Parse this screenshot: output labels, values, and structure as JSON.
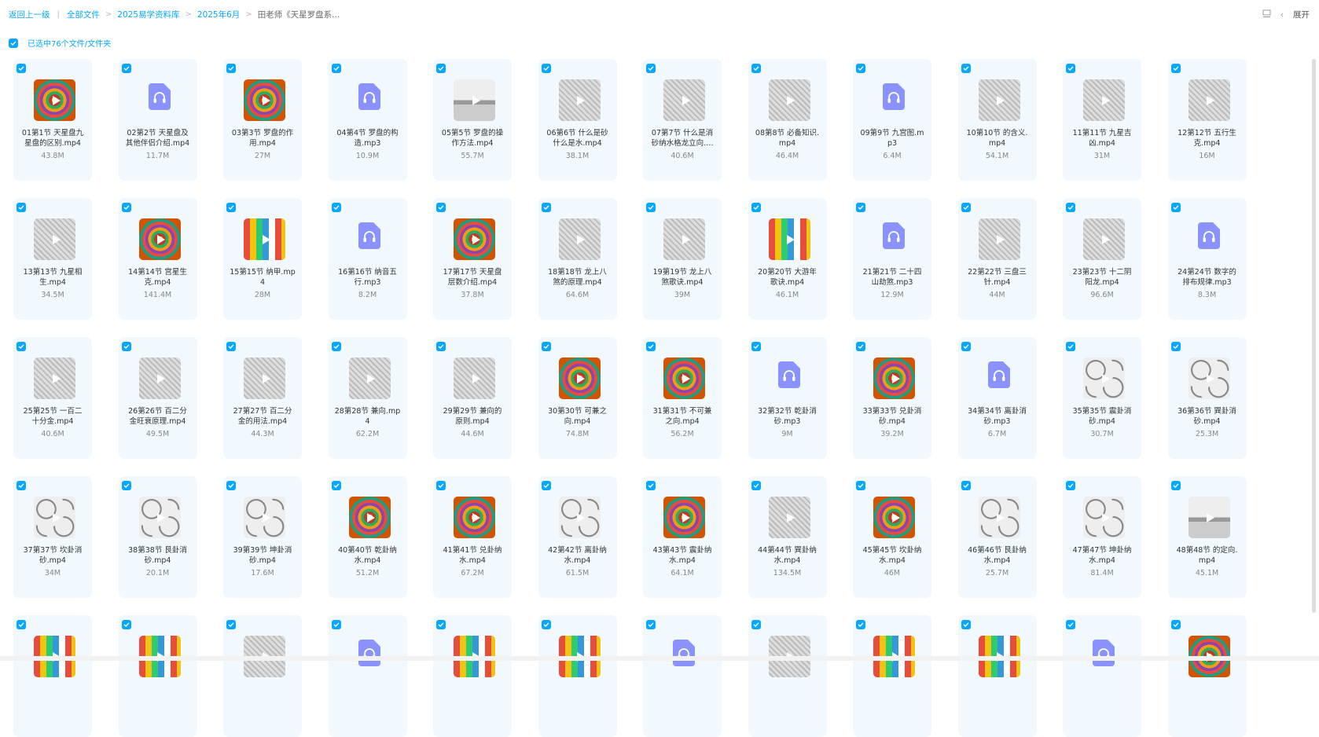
{
  "breadcrumb": {
    "back": "返回上一级",
    "items": [
      "全部文件",
      "2025易学资料库",
      "2025年6月"
    ],
    "current": "田老师《天星罗盘系..."
  },
  "toolbar": {
    "expand_label": "展开",
    "collapse_chevron": "‹"
  },
  "selection": {
    "label": "已选中76个文件/文件夹"
  },
  "colors": {
    "accent": "#06a7ff",
    "card_bg": "#f1f8fe",
    "audio_icon": "#8a92ff"
  },
  "files": [
    {
      "name": "01第1节 天星盘九星盘的区别.mp4",
      "size": "43.8M",
      "type": "video",
      "thumb": "v2"
    },
    {
      "name": "02第2节 天星盘及其他伴侣介绍.mp4",
      "size": "11.7M",
      "type": "audio"
    },
    {
      "name": "03第3节 罗盘的作用.mp4",
      "size": "27M",
      "type": "video",
      "thumb": "v2"
    },
    {
      "name": "04第4节 罗盘的构造.mp3",
      "size": "10.9M",
      "type": "audio"
    },
    {
      "name": "05第5节 罗盘的操作方法.mp4",
      "size": "55.7M",
      "type": "video",
      "thumb": "v3"
    },
    {
      "name": "06第6节 什么是砂什么是水.mp4",
      "size": "38.1M",
      "type": "video",
      "thumb": "v1"
    },
    {
      "name": "07第7节 什么是消砂纳水格龙立向.mp4",
      "size": "40.6M",
      "type": "video",
      "thumb": "v1"
    },
    {
      "name": "08第8节 必备知识.mp4",
      "size": "46.4M",
      "type": "video",
      "thumb": "v1"
    },
    {
      "name": "09第9节 九宫图.mp3",
      "size": "6.4M",
      "type": "audio"
    },
    {
      "name": "10第10节 的含义.mp4",
      "size": "54.1M",
      "type": "video",
      "thumb": "v1"
    },
    {
      "name": "11第11节 九星吉凶.mp4",
      "size": "31M",
      "type": "video",
      "thumb": "v1"
    },
    {
      "name": "12第12节 五行生克.mp4",
      "size": "16M",
      "type": "video",
      "thumb": "v1"
    },
    {
      "name": "13第13节 九星相生.mp4",
      "size": "34.5M",
      "type": "video",
      "thumb": "v1"
    },
    {
      "name": "14第14节 宫星生克.mp4",
      "size": "141.4M",
      "type": "video",
      "thumb": "v2"
    },
    {
      "name": "15第15节 纳甲.mp4",
      "size": "28M",
      "type": "video",
      "thumb": "v4"
    },
    {
      "name": "16第16节 纳音五行.mp3",
      "size": "8.2M",
      "type": "audio"
    },
    {
      "name": "17第17节 天星盘层数介绍.mp4",
      "size": "37.8M",
      "type": "video",
      "thumb": "v2"
    },
    {
      "name": "18第18节 龙上八煞的原理.mp4",
      "size": "64.6M",
      "type": "video",
      "thumb": "v1"
    },
    {
      "name": "19第19节 龙上八煞歌诀.mp4",
      "size": "39M",
      "type": "video",
      "thumb": "v1"
    },
    {
      "name": "20第20节 大游年歌诀.mp4",
      "size": "46.1M",
      "type": "video",
      "thumb": "v4"
    },
    {
      "name": "21第21节 二十四山劫煞.mp3",
      "size": "12.9M",
      "type": "audio"
    },
    {
      "name": "22第22节 三盘三针.mp4",
      "size": "44M",
      "type": "video",
      "thumb": "v1"
    },
    {
      "name": "23第23节 十二阴阳龙.mp4",
      "size": "96.6M",
      "type": "video",
      "thumb": "v1"
    },
    {
      "name": "24第24节 数字的排布规律.mp3",
      "size": "8.3M",
      "type": "audio"
    },
    {
      "name": "25第25节 一百二十分金.mp4",
      "size": "40.6M",
      "type": "video",
      "thumb": "v1"
    },
    {
      "name": "26第26节 百二分金旺衰原理.mp4",
      "size": "49.5M",
      "type": "video",
      "thumb": "v1"
    },
    {
      "name": "27第27节 百二分金的用法.mp4",
      "size": "44.3M",
      "type": "video",
      "thumb": "v1"
    },
    {
      "name": "28第28节 兼向.mp4",
      "size": "62.2M",
      "type": "video",
      "thumb": "v1"
    },
    {
      "name": "29第29节 兼向的原则.mp4",
      "size": "44.6M",
      "type": "video",
      "thumb": "v1"
    },
    {
      "name": "30第30节 可兼之向.mp4",
      "size": "74.8M",
      "type": "video",
      "thumb": "v2"
    },
    {
      "name": "31第31节 不可兼之向.mp4",
      "size": "56.2M",
      "type": "video",
      "thumb": "v2"
    },
    {
      "name": "32第32节 乾卦消砂.mp3",
      "size": "9M",
      "type": "audio"
    },
    {
      "name": "33第33节 兑卦消砂.mp4",
      "size": "39.2M",
      "type": "video",
      "thumb": "v2"
    },
    {
      "name": "34第34节 离卦消砂.mp3",
      "size": "6.7M",
      "type": "audio"
    },
    {
      "name": "35第35节 震卦消砂.mp4",
      "size": "30.7M",
      "type": "video",
      "thumb": "v5"
    },
    {
      "name": "36第36节 巽卦消砂.mp4",
      "size": "25.3M",
      "type": "video",
      "thumb": "v5"
    },
    {
      "name": "37第37节 坎卦消砂.mp4",
      "size": "34M",
      "type": "video",
      "thumb": "v5"
    },
    {
      "name": "38第38节 艮卦消砂.mp4",
      "size": "20.1M",
      "type": "video",
      "thumb": "v5"
    },
    {
      "name": "39第39节 坤卦消砂.mp4",
      "size": "17.6M",
      "type": "video",
      "thumb": "v5"
    },
    {
      "name": "40第40节 乾卦纳水.mp4",
      "size": "51.2M",
      "type": "video",
      "thumb": "v2"
    },
    {
      "name": "41第41节 兑卦纳水.mp4",
      "size": "67.2M",
      "type": "video",
      "thumb": "v2"
    },
    {
      "name": "42第42节 离卦纳水.mp4",
      "size": "61.5M",
      "type": "video",
      "thumb": "v5"
    },
    {
      "name": "43第43节 震卦纳水.mp4",
      "size": "64.1M",
      "type": "video",
      "thumb": "v2"
    },
    {
      "name": "44第44节 巽卦纳水.mp4",
      "size": "134.5M",
      "type": "video",
      "thumb": "v1"
    },
    {
      "name": "45第45节 坎卦纳水.mp4",
      "size": "46M",
      "type": "video",
      "thumb": "v2"
    },
    {
      "name": "46第46节 艮卦纳水.mp4",
      "size": "25.7M",
      "type": "video",
      "thumb": "v5"
    },
    {
      "name": "47第47节 坤卦纳水.mp4",
      "size": "81.4M",
      "type": "video",
      "thumb": "v5"
    },
    {
      "name": "48第48节 的定向.mp4",
      "size": "45.1M",
      "type": "video",
      "thumb": "v3"
    },
    {
      "name": "",
      "size": "",
      "type": "video",
      "thumb": "v4"
    },
    {
      "name": "",
      "size": "",
      "type": "video",
      "thumb": "v4"
    },
    {
      "name": "",
      "size": "",
      "type": "video",
      "thumb": "v1"
    },
    {
      "name": "",
      "size": "",
      "type": "audio"
    },
    {
      "name": "",
      "size": "",
      "type": "video",
      "thumb": "v4"
    },
    {
      "name": "",
      "size": "",
      "type": "video",
      "thumb": "v4"
    },
    {
      "name": "",
      "size": "",
      "type": "audio"
    },
    {
      "name": "",
      "size": "",
      "type": "video",
      "thumb": "v1"
    },
    {
      "name": "",
      "size": "",
      "type": "video",
      "thumb": "v4"
    },
    {
      "name": "",
      "size": "",
      "type": "video",
      "thumb": "v4"
    },
    {
      "name": "",
      "size": "",
      "type": "audio"
    },
    {
      "name": "",
      "size": "",
      "type": "video",
      "thumb": "v2"
    }
  ]
}
